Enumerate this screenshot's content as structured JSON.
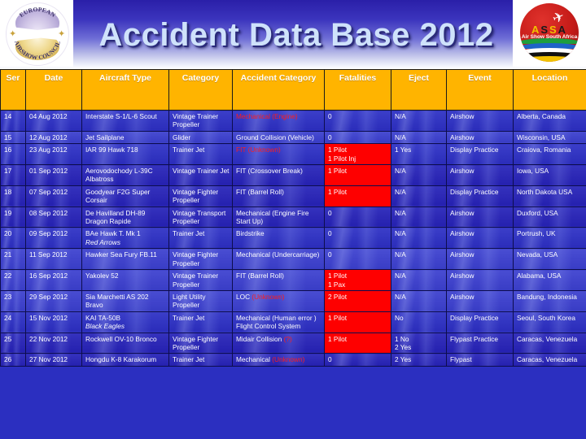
{
  "header": {
    "title": "Accident Data Base 2012",
    "left_logo": {
      "name": "European Airshow Council",
      "ring_top": "EUROPEAN",
      "ring_bottom": "AIRSHOW COUNCIL"
    },
    "right_logo": {
      "name": "Air Show South Africa",
      "acronym_a1": "A",
      "acronym_s1": "S",
      "acronym_s2": "S",
      "acronym_a2": "A",
      "subtitle": "Air Show South Africa"
    }
  },
  "colors": {
    "header_row": "#ffb400",
    "cell_blue": "#2c2fc4",
    "fatality_red": "#fe0000",
    "red_text": "#ff1d1d",
    "title_text": "#cfe2fb"
  },
  "table": {
    "columns": [
      "Ser",
      "Date",
      "Aircraft Type",
      "Category",
      "Accident Category",
      "Fatalities",
      "Eject",
      "Event",
      "Location"
    ],
    "rows": [
      {
        "ser": "14",
        "date": "04 Aug 2012",
        "aircraft": "Interstate S-1/L-6 Scout",
        "aircraft_italic": "",
        "category": "Vintage Trainer Propeller",
        "accident_category": "Mechanical (Engine)",
        "accident_category_red": true,
        "fatalities": "0",
        "fatalities_hot": false,
        "eject": "N/A",
        "event": "Airshow",
        "location": "Alberta, Canada"
      },
      {
        "ser": "15",
        "date": "12 Aug 2012",
        "aircraft": "Jet Sailplane",
        "aircraft_italic": "",
        "category": "Glider",
        "accident_category": "Ground Collision (Vehicle)",
        "accident_category_red": false,
        "fatalities": "0",
        "fatalities_hot": false,
        "eject": "N/A",
        "event": "Airshow",
        "location": "Wisconsin, USA"
      },
      {
        "ser": "16",
        "date": "23 Aug 2012",
        "aircraft": "IAR 99 Hawk 718",
        "aircraft_italic": "",
        "category": "Trainer Jet",
        "accident_category": "FIT (Unknown)",
        "accident_category_red": true,
        "fatalities": "1 Pilot\n1 Pilot Inj",
        "fatalities_hot": true,
        "eject": "1 Yes",
        "event": "Display Practice",
        "location": "Craiova, Romania"
      },
      {
        "ser": "17",
        "date": "01 Sep 2012",
        "aircraft": "Aerovodochody L-39C Albatross",
        "aircraft_italic": "",
        "category": "Vintage Trainer Jet",
        "accident_category": "FIT (Crossover Break)",
        "accident_category_red": false,
        "fatalities": "1 Pilot",
        "fatalities_hot": true,
        "eject": "N/A",
        "event": "Airshow",
        "location": "Iowa, USA"
      },
      {
        "ser": "18",
        "date": "07 Sep 2012",
        "aircraft": "Goodyear F2G Super Corsair",
        "aircraft_italic": "",
        "category": "Vintage Fighter Propeller",
        "accident_category": "FIT (Barrel Roll)",
        "accident_category_red": false,
        "fatalities": "1 Pilot",
        "fatalities_hot": true,
        "eject": "N/A",
        "event": "Display Practice",
        "location": "North Dakota USA"
      },
      {
        "ser": "19",
        "date": "08 Sep 2012",
        "aircraft": "De Havilland DH-89 Dragon Rapide",
        "aircraft_italic": "",
        "category": "Vintage Transport Propeller",
        "accident_category": "Mechanical (Engine Fire Start Up)",
        "accident_category_red": false,
        "fatalities": "0",
        "fatalities_hot": false,
        "eject": "N/A",
        "event": "Airshow",
        "location": "Duxford, USA"
      },
      {
        "ser": "20",
        "date": "09 Sep 2012",
        "aircraft": "BAe Hawk T. Mk 1",
        "aircraft_italic": "Red Arrows",
        "category": "Trainer Jet",
        "accident_category": "Birdstrike",
        "accident_category_red": false,
        "fatalities": "0",
        "fatalities_hot": false,
        "eject": "N/A",
        "event": "Airshow",
        "location": "Portrush, UK"
      },
      {
        "ser": "21",
        "date": "11 Sep 2012",
        "aircraft": "Hawker Sea Fury FB.11",
        "aircraft_italic": "",
        "category": "Vintage Fighter Propeller",
        "accident_category": "Mechanical (Undercarriage)",
        "accident_category_red": false,
        "fatalities": "0",
        "fatalities_hot": false,
        "eject": "N/A",
        "event": "Airshow",
        "location": "Nevada, USA"
      },
      {
        "ser": "22",
        "date": "16 Sep 2012",
        "aircraft": "Yakolev 52",
        "aircraft_italic": "",
        "category": "Vintage Trainer Propeller",
        "accident_category": "FIT (Barrel Roll)",
        "accident_category_red": false,
        "fatalities": "1 Pilot\n1 Pax",
        "fatalities_hot": true,
        "eject": "N/A",
        "event": "Airshow",
        "location": "Alabama, USA"
      },
      {
        "ser": "23",
        "date": "29 Sep 2012",
        "aircraft": "Sia Marchetti AS 202 Bravo",
        "aircraft_italic": "",
        "category": "Light Utility Propeller",
        "accident_category": "LOC (Unknown)",
        "accident_category_red": false,
        "accident_category_partial_red": "(Unknown)",
        "fatalities": "2 Pilot",
        "fatalities_hot": true,
        "eject": "N/A",
        "event": "Airshow",
        "location": "Bandung, Indonesia"
      },
      {
        "ser": "24",
        "date": "15 Nov 2012",
        "aircraft": "KAI TA-50B",
        "aircraft_italic": "Black Eagles",
        "category": "Trainer Jet",
        "accident_category": "Mechanical (Human error ) Flight Control System",
        "accident_category_red": false,
        "fatalities": "1 Pilot",
        "fatalities_hot": true,
        "eject": "No",
        "event": "Display Practice",
        "location": "Seoul, South Korea"
      },
      {
        "ser": "25",
        "date": "22 Nov 2012",
        "aircraft": "Rockwell OV-10 Bronco",
        "aircraft_italic": "",
        "category": "Vintage Fighter Propeller",
        "accident_category": "Midair Collision (?)",
        "accident_category_red": false,
        "accident_category_partial_red": "(?)",
        "fatalities": "1 Pilot",
        "fatalities_hot": true,
        "eject": "1 No\n2 Yes",
        "event": "Flypast Practice",
        "location": "Caracas, Venezuela"
      },
      {
        "ser": "26",
        "date": "27 Nov 2012",
        "aircraft": "Hongdu K-8 Karakorum",
        "aircraft_italic": "",
        "category": "Trainer Jet",
        "accident_category": "Mechanical (Unknown)",
        "accident_category_red": false,
        "accident_category_partial_red": "(Unknown)",
        "fatalities": "0",
        "fatalities_hot": false,
        "eject": "2 Yes",
        "event": "Flypast",
        "location": "Caracas, Venezuela"
      }
    ]
  }
}
